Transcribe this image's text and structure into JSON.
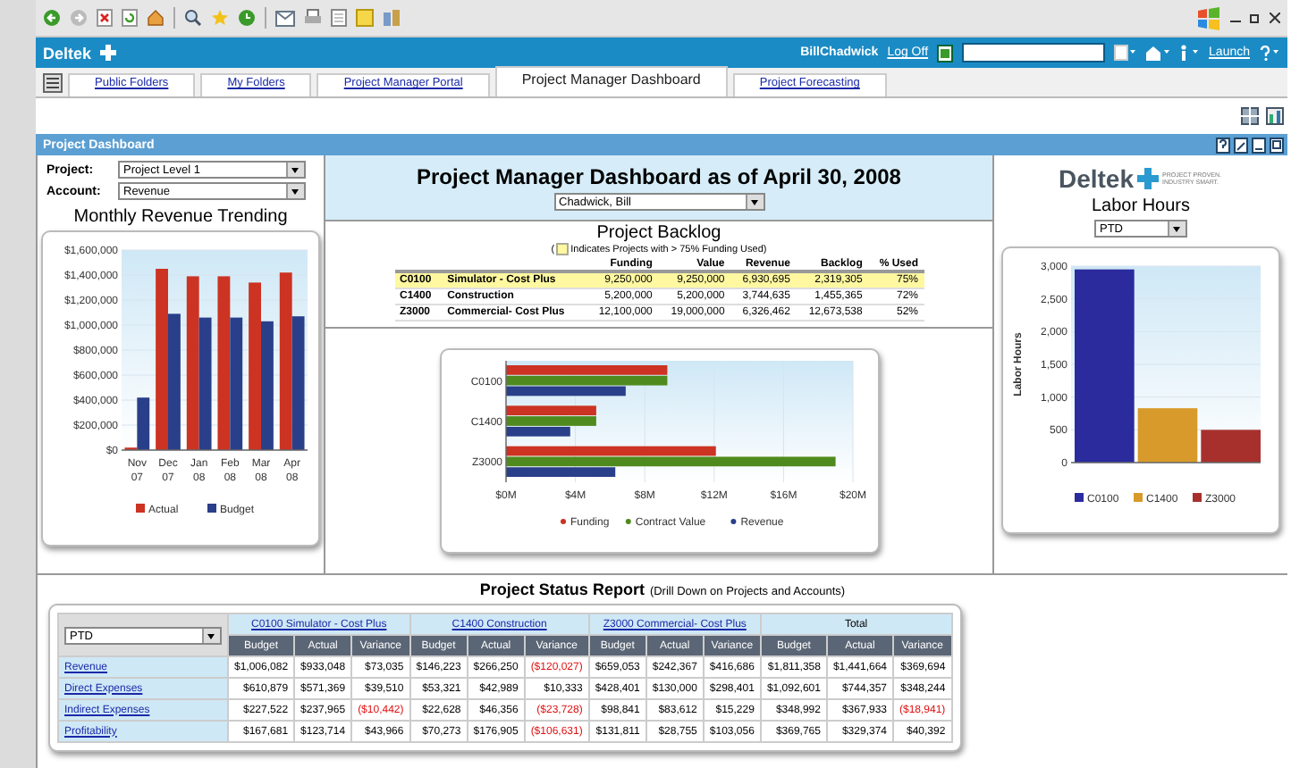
{
  "app_bar": {
    "logo": "Deltek",
    "user": "BillChadwick",
    "logoff": "Log Off",
    "launch": "Launch"
  },
  "tabs": [
    {
      "label": "Public Folders",
      "selected": false
    },
    {
      "label": "My Folders",
      "selected": false
    },
    {
      "label": "Project Manager Portal",
      "selected": false
    },
    {
      "label": "Project Manager Dashboard",
      "selected": true
    },
    {
      "label": "Project Forecasting",
      "selected": false
    }
  ],
  "panel": {
    "title": "Project Dashboard"
  },
  "filters": [
    {
      "label": "Project:",
      "value": "Project Level 1"
    },
    {
      "label": "Account:",
      "value": "Revenue"
    }
  ],
  "revenue": {
    "title": "Monthly Revenue Trending",
    "chart_data": {
      "type": "bar",
      "categories": [
        "Nov 07",
        "Dec 07",
        "Jan 08",
        "Feb 08",
        "Mar 08",
        "Apr 08"
      ],
      "ylim": [
        0,
        1600000
      ],
      "yticks": [
        {
          "value": 0,
          "label": "$0"
        },
        {
          "value": 200000,
          "label": "$200,000"
        },
        {
          "value": 400000,
          "label": "$400,000"
        },
        {
          "value": 600000,
          "label": "$600,000"
        },
        {
          "value": 800000,
          "label": "$800,000"
        },
        {
          "value": 1000000,
          "label": "$1,000,000"
        },
        {
          "value": 1200000,
          "label": "$1,200,000"
        },
        {
          "value": 1400000,
          "label": "$1,400,000"
        },
        {
          "value": 1600000,
          "label": "$1,600,000"
        }
      ],
      "grid": true,
      "legend": "bottom",
      "series": [
        {
          "name": "Actual",
          "color": "#cc3322",
          "values": [
            20000,
            1450000,
            1390000,
            1390000,
            1340000,
            1420000
          ]
        },
        {
          "name": "Budget",
          "color": "#2a3f8a",
          "values": [
            420000,
            1090000,
            1060000,
            1060000,
            1030000,
            1070000
          ]
        }
      ]
    }
  },
  "header": {
    "title": "Project Manager Dashboard as of April 30, 2008",
    "manager": "Chadwick, Bill"
  },
  "backlog": {
    "title": "Project Backlog",
    "note_open": "(",
    "note": "Indicates Projects with > 75% Funding Used)",
    "columns": [
      "Funding",
      "Value",
      "Revenue",
      "Backlog",
      "% Used"
    ],
    "rows": [
      {
        "code": "C0100",
        "name": "Simulator - Cost Plus",
        "highlighted": true,
        "cells": [
          "9,250,000",
          "9,250,000",
          "6,930,695",
          "2,319,305",
          "75%"
        ]
      },
      {
        "code": "C1400",
        "name": "Construction",
        "highlighted": false,
        "cells": [
          "5,200,000",
          "5,200,000",
          "3,744,635",
          "1,455,365",
          "72%"
        ]
      },
      {
        "code": "Z3000",
        "name": "Commercial- Cost Plus",
        "highlighted": false,
        "cells": [
          "12,100,000",
          "19,000,000",
          "6,326,462",
          "12,673,538",
          "52%"
        ]
      }
    ],
    "chart_data": {
      "type": "bar",
      "orientation": "horizontal",
      "categories": [
        "C0100",
        "C1400",
        "Z3000"
      ],
      "xlim": [
        0,
        20000000
      ],
      "xticks": [
        {
          "value": 0,
          "label": "$0M"
        },
        {
          "value": 4000000,
          "label": "$4M"
        },
        {
          "value": 8000000,
          "label": "$8M"
        },
        {
          "value": 12000000,
          "label": "$12M"
        },
        {
          "value": 16000000,
          "label": "$16M"
        },
        {
          "value": 20000000,
          "label": "$20M"
        }
      ],
      "grid": true,
      "legend": "bottom",
      "series": [
        {
          "name": "Funding",
          "color": "#cc3322",
          "values": [
            9300000,
            5200000,
            12100000
          ]
        },
        {
          "name": "Contract Value",
          "color": "#4f8a1e",
          "values": [
            9300000,
            5200000,
            19000000
          ]
        },
        {
          "name": "Revenue",
          "color": "#2a3f8a",
          "values": [
            6900000,
            3700000,
            6300000
          ]
        }
      ]
    }
  },
  "labor": {
    "logo": "Deltek",
    "tagline": "PROJECT PROVEN. INDUSTRY SMART.",
    "title": "Labor Hours",
    "period": "PTD",
    "chart_data": {
      "type": "bar",
      "ylabel": "Labor Hours",
      "grid": true,
      "legend": "bottom",
      "ylim": [
        0,
        3000
      ],
      "yticks": [
        {
          "value": 0,
          "label": "0"
        },
        {
          "value": 500,
          "label": "500"
        },
        {
          "value": 1000,
          "label": "1,000"
        },
        {
          "value": 1500,
          "label": "1,500"
        },
        {
          "value": 2000,
          "label": "2,000"
        },
        {
          "value": 2500,
          "label": "2,500"
        },
        {
          "value": 3000,
          "label": "3,000"
        }
      ],
      "series": [
        {
          "name": "C0100",
          "color": "#2b2b9e",
          "values": [
            2950,
            null,
            null
          ]
        },
        {
          "name": "C1400",
          "color": "#d89a2a",
          "values": [
            null,
            830,
            null
          ]
        },
        {
          "name": "Z3000",
          "color": "#a8302c",
          "values": [
            null,
            null,
            500
          ]
        }
      ]
    }
  },
  "status_report": {
    "title": "Project Status Report",
    "subtitle": "(Drill Down on Projects and Accounts)",
    "period": "PTD",
    "groups": [
      {
        "label": "C0100 Simulator - Cost Plus",
        "link": true
      },
      {
        "label": "C1400 Construction",
        "link": true
      },
      {
        "label": "Z3000 Commercial- Cost Plus",
        "link": true
      },
      {
        "label": "Total",
        "link": false
      }
    ],
    "subcolumns": [
      "Budget",
      "Actual",
      "Variance",
      "Budget",
      "Actual",
      "Variance",
      "Budget",
      "Actual",
      "Variance",
      "Budget",
      "Actual",
      "Variance"
    ],
    "rows": [
      {
        "label": "Revenue",
        "cells": [
          {
            "text": "$1,006,082",
            "negative": false
          },
          {
            "text": "$933,048",
            "negative": false
          },
          {
            "text": "$73,035",
            "negative": false
          },
          {
            "text": "$146,223",
            "negative": false
          },
          {
            "text": "$266,250",
            "negative": false
          },
          {
            "text": "($120,027)",
            "negative": true
          },
          {
            "text": "$659,053",
            "negative": false
          },
          {
            "text": "$242,367",
            "negative": false
          },
          {
            "text": "$416,686",
            "negative": false
          },
          {
            "text": "$1,811,358",
            "negative": false
          },
          {
            "text": "$1,441,664",
            "negative": false
          },
          {
            "text": "$369,694",
            "negative": false
          }
        ]
      },
      {
        "label": "Direct Expenses",
        "cells": [
          {
            "text": "$610,879",
            "negative": false
          },
          {
            "text": "$571,369",
            "negative": false
          },
          {
            "text": "$39,510",
            "negative": false
          },
          {
            "text": "$53,321",
            "negative": false
          },
          {
            "text": "$42,989",
            "negative": false
          },
          {
            "text": "$10,333",
            "negative": false
          },
          {
            "text": "$428,401",
            "negative": false
          },
          {
            "text": "$130,000",
            "negative": false
          },
          {
            "text": "$298,401",
            "negative": false
          },
          {
            "text": "$1,092,601",
            "negative": false
          },
          {
            "text": "$744,357",
            "negative": false
          },
          {
            "text": "$348,244",
            "negative": false
          }
        ]
      },
      {
        "label": "Indirect Expenses",
        "cells": [
          {
            "text": "$227,522",
            "negative": false
          },
          {
            "text": "$237,965",
            "negative": false
          },
          {
            "text": "($10,442)",
            "negative": true
          },
          {
            "text": "$22,628",
            "negative": false
          },
          {
            "text": "$46,356",
            "negative": false
          },
          {
            "text": "($23,728)",
            "negative": true
          },
          {
            "text": "$98,841",
            "negative": false
          },
          {
            "text": "$83,612",
            "negative": false
          },
          {
            "text": "$15,229",
            "negative": false
          },
          {
            "text": "$348,992",
            "negative": false
          },
          {
            "text": "$367,933",
            "negative": false
          },
          {
            "text": "($18,941)",
            "negative": true
          }
        ]
      },
      {
        "label": "Profitability",
        "cells": [
          {
            "text": "$167,681",
            "negative": false
          },
          {
            "text": "$123,714",
            "negative": false
          },
          {
            "text": "$43,966",
            "negative": false
          },
          {
            "text": "$70,273",
            "negative": false
          },
          {
            "text": "$176,905",
            "negative": false
          },
          {
            "text": "($106,631)",
            "negative": true
          },
          {
            "text": "$131,811",
            "negative": false
          },
          {
            "text": "$28,755",
            "negative": false
          },
          {
            "text": "$103,056",
            "negative": false
          },
          {
            "text": "$369,765",
            "negative": false
          },
          {
            "text": "$329,374",
            "negative": false
          },
          {
            "text": "$40,392",
            "negative": false
          }
        ]
      }
    ]
  }
}
